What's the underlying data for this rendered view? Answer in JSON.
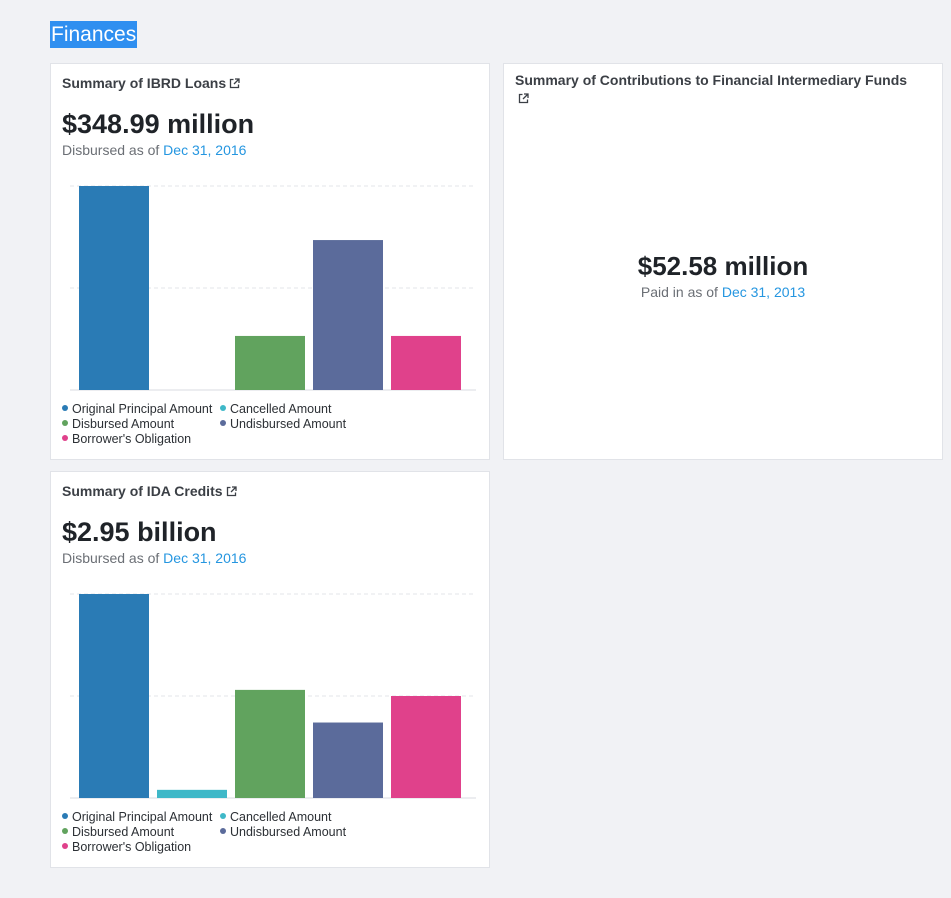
{
  "section": {
    "title": "Finances"
  },
  "colors": {
    "original": "#2a7bb5",
    "cancelled": "#3fb8c8",
    "disbursed": "#61a35e",
    "undisbursed": "#5b6b9b",
    "obligation": "#e0418b",
    "link": "#2596e0"
  },
  "ibrd": {
    "title": "Summary of IBRD Loans",
    "value": "$348.99 million",
    "sub_prefix": "Disbursed as of",
    "date": "Dec 31, 2016"
  },
  "fif": {
    "title": "Summary of Contributions to Financial Intermediary Funds",
    "value": "$52.58 million",
    "sub_prefix": "Paid in as of",
    "date": "Dec 31, 2013"
  },
  "ida": {
    "title": "Summary of IDA Credits",
    "value": "$2.95 billion",
    "sub_prefix": "Disbursed as of",
    "date": "Dec 31, 2016"
  },
  "legend": {
    "original": "Original Principal Amount",
    "cancelled": "Cancelled Amount",
    "disbursed": "Disbursed Amount",
    "undisbursed": "Undisbursed Amount",
    "obligation": "Borrower's Obligation"
  },
  "chart_data": [
    {
      "type": "bar",
      "categories": [
        "Original Principal Amount",
        "Cancelled Amount",
        "Disbursed Amount",
        "Undisbursed Amount",
        "Borrower's Obligation"
      ],
      "values": [
        1.0,
        0.0,
        0.265,
        0.735,
        0.265
      ],
      "ylim": [
        0,
        1.0
      ],
      "grid": true,
      "legend": "bottom"
    },
    {
      "type": "bar",
      "categories": [
        "Original Principal Amount",
        "Cancelled Amount",
        "Disbursed Amount",
        "Undisbursed Amount",
        "Borrower's Obligation"
      ],
      "values": [
        1.0,
        0.04,
        0.53,
        0.37,
        0.5
      ],
      "ylim": [
        0,
        1.0
      ],
      "grid": true,
      "legend": "bottom"
    }
  ]
}
